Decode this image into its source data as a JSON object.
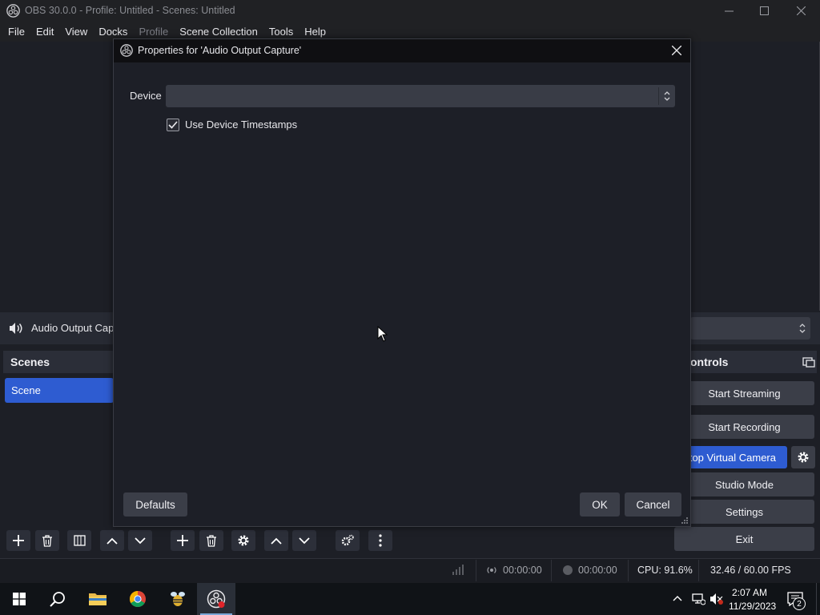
{
  "window": {
    "title": "OBS 30.0.0 - Profile: Untitled - Scenes: Untitled"
  },
  "menu": {
    "items": [
      "File",
      "Edit",
      "View",
      "Docks",
      "Profile",
      "Scene Collection",
      "Tools",
      "Help"
    ],
    "disabled": [
      "Profile"
    ]
  },
  "sources": {
    "visible_label": "Audio Output Cap"
  },
  "scenes": {
    "header": "Scenes",
    "items": [
      "Scene"
    ]
  },
  "controls": {
    "header": "ontrols",
    "start_streaming": "Start Streaming",
    "start_recording": "Start Recording",
    "virtual_camera": "top Virtual Camera",
    "studio_mode": "Studio Mode",
    "settings": "Settings",
    "exit": "Exit"
  },
  "status": {
    "stream_time": "00:00:00",
    "record_time": "00:00:00",
    "cpu": "CPU: 91.6%",
    "fps": "32.46 / 60.00 FPS"
  },
  "dialog": {
    "title": "Properties for 'Audio Output Capture'",
    "device_label": "Device",
    "device_value": "",
    "use_device_timestamps_label": "Use Device Timestamps",
    "use_device_timestamps_checked": true,
    "defaults_button": "Defaults",
    "ok_button": "OK",
    "cancel_button": "Cancel"
  },
  "taskbar": {
    "time": "2:07 AM",
    "date": "11/29/2023",
    "notifications": "2"
  },
  "colors": {
    "accent": "#2e5cd1",
    "panel": "#272a33",
    "dialog_bg": "#1d1f27",
    "button": "#3b3e48"
  }
}
